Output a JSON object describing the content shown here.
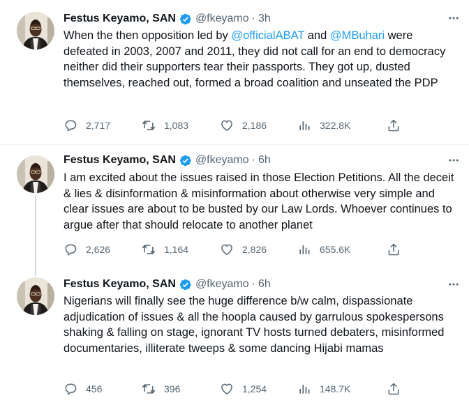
{
  "tweets": [
    {
      "name": "Festus Keyamo, SAN",
      "handle": "@fkeyamo",
      "separator": "·",
      "time": "3h",
      "text_parts": [
        "When the then opposition led by ",
        "@officialABAT",
        " and ",
        "@MBuhari",
        " were defeated in 2003, 2007 and 2011, they did not call for an end to democracy neither did their supporters tear their passports. They got up, dusted themselves, reached out, formed a broad coalition and unseated the PDP"
      ],
      "replies": "2,717",
      "retweets": "1,083",
      "likes": "2,186",
      "views": "322.8K"
    },
    {
      "name": "Festus Keyamo, SAN",
      "handle": "@fkeyamo",
      "separator": "·",
      "time": "6h",
      "text": "I am excited about the issues raised in those Election Petitions. All the deceit & lies & disinformation & misinformation about otherwise very simple and clear issues are about to be busted by our Law Lords. Whoever continues to argue after that should relocate to another planet",
      "replies": "2,626",
      "retweets": "1,164",
      "likes": "2,826",
      "views": "655.6K"
    },
    {
      "name": "Festus Keyamo, SAN",
      "handle": "@fkeyamo",
      "separator": "·",
      "time": "6h",
      "text": "Nigerians will finally see the huge difference b/w calm, dispassionate adjudication of issues & all the hoopla caused by garrulous spokespersons shaking & falling on stage, ignorant TV hosts turned debaters, misinformed documentaries, illiterate tweeps & some dancing Hijabi mamas",
      "replies": "456",
      "retweets": "396",
      "likes": "1,254",
      "views": "148.7K"
    }
  ],
  "icons": {
    "verified": "verified-badge-icon",
    "more": "more-dots-icon",
    "reply": "reply-icon",
    "retweet": "retweet-icon",
    "like": "heart-icon",
    "views": "views-chart-icon",
    "share": "share-icon"
  },
  "colors": {
    "accent": "#1d9bf0",
    "secondary_text": "#536471",
    "divider": "#eff3f4",
    "thread_line": "#cfd9de"
  }
}
